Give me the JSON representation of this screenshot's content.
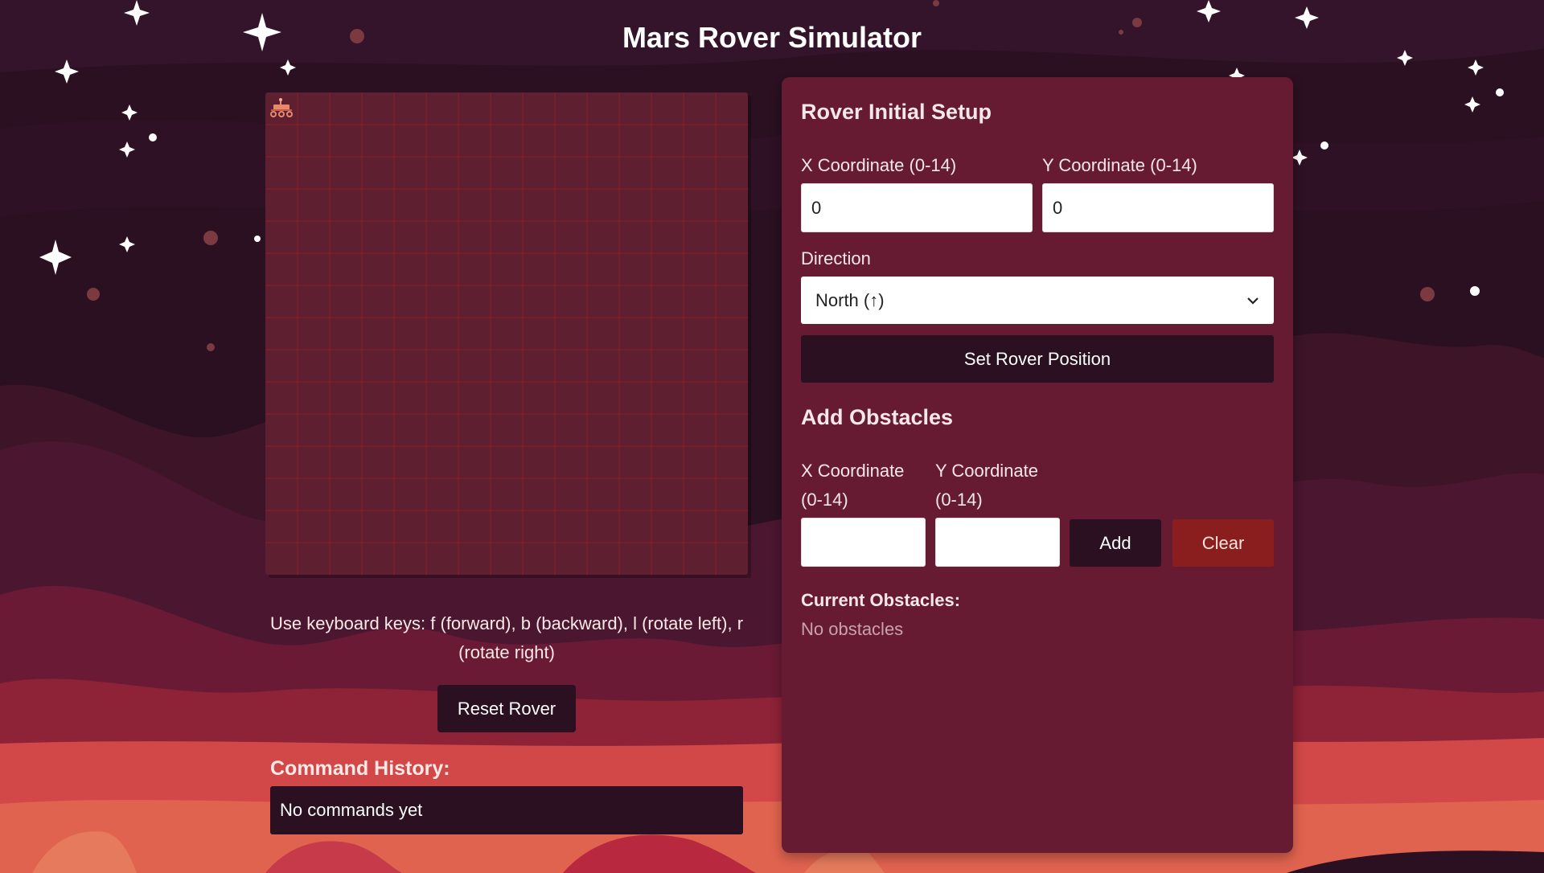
{
  "app": {
    "title": "Mars Rover Simulator"
  },
  "grid": {
    "size": 15,
    "rover": {
      "x": 0,
      "y": 0,
      "direction": "N"
    }
  },
  "controls": {
    "hint": "Use keyboard keys: f (forward), b (backward), l (rotate left), r (rotate right)",
    "reset_label": "Reset Rover",
    "history_label": "Command History:",
    "history_empty": "No commands yet"
  },
  "setup": {
    "heading": "Rover Initial Setup",
    "x_label": "X Coordinate (0-14)",
    "y_label": "Y Coordinate (0-14)",
    "x_value": "0",
    "y_value": "0",
    "direction_label": "Direction",
    "direction_value": "North (↑)",
    "set_label": "Set Rover Position"
  },
  "obstacles": {
    "heading": "Add Obstacles",
    "x_label_1": "X Coordinate",
    "x_label_2": "(0-14)",
    "y_label_1": "Y Coordinate",
    "y_label_2": "(0-14)",
    "add_label": "Add",
    "clear_label": "Clear",
    "current_label": "Current Obstacles:",
    "empty_text": "No obstacles"
  },
  "colors": {
    "sky": "#2a1020",
    "panel": "#671b32",
    "grid_bg": "#5e1f30",
    "grid_line": "#8c1f24",
    "clear_button": "#8a1e1e",
    "ground": "#d24848"
  }
}
